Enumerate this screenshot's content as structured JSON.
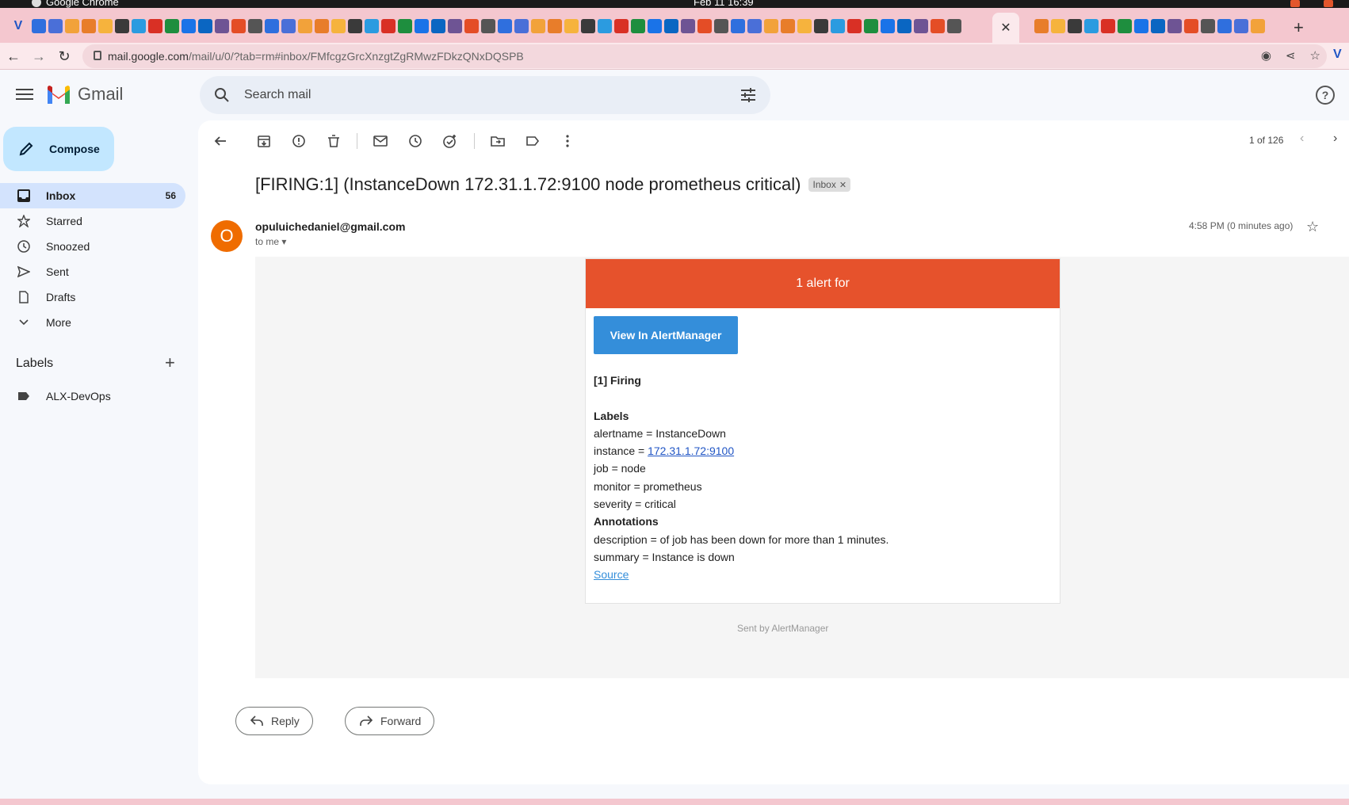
{
  "os": {
    "app_name": "Google Chrome",
    "clock": "Feb 11  16:39"
  },
  "browser": {
    "url_host": "mail.google.com",
    "url_path": "/mail/u/0/?tab=rm#inbox/FMfcgzGrcXnzgtZgRMwzFDkzQNxDQSPB"
  },
  "gmail": {
    "app_name": "Gmail",
    "search_placeholder": "Search mail",
    "compose_label": "Compose",
    "nav": [
      {
        "label": "Inbox",
        "count": "56",
        "icon": "inbox-icon"
      },
      {
        "label": "Starred",
        "icon": "star-icon"
      },
      {
        "label": "Snoozed",
        "icon": "clock-icon"
      },
      {
        "label": "Sent",
        "icon": "send-icon"
      },
      {
        "label": "Drafts",
        "icon": "draft-icon"
      },
      {
        "label": "More",
        "icon": "chevron-down-icon"
      }
    ],
    "labels_heading": "Labels",
    "labels": [
      {
        "label": "ALX-DevOps",
        "icon": "label-icon"
      }
    ],
    "pager": "1 of 126"
  },
  "message": {
    "subject": "[FIRING:1] (InstanceDown 172.31.1.72:9100 node prometheus critical)",
    "chip": "Inbox",
    "avatar_letter": "O",
    "sender": "opuluichedaniel@gmail.com",
    "to": "to me",
    "time": "4:58 PM (0 minutes ago)"
  },
  "alert": {
    "header": "1 alert for",
    "button": "View In AlertManager",
    "firing": "[1] Firing",
    "labels_title": "Labels",
    "alertname": "alertname = InstanceDown",
    "instance_prefix": "instance = ",
    "instance_link": "172.31.1.72:9100",
    "job": "job = node",
    "monitor": "monitor = prometheus",
    "severity": "severity = critical",
    "annotations_title": "Annotations",
    "description": "description = of job has been down for more than 1 minutes.",
    "summary": "summary = Instance is down",
    "source": "Source",
    "sent_by": "Sent by AlertManager"
  },
  "actions": {
    "reply": "Reply",
    "forward": "Forward"
  },
  "colors": {
    "alert_red": "#e6522c",
    "button_blue": "#348eda",
    "compose_bg": "#c2e7ff",
    "tab_pink": "#f4c7cf"
  }
}
